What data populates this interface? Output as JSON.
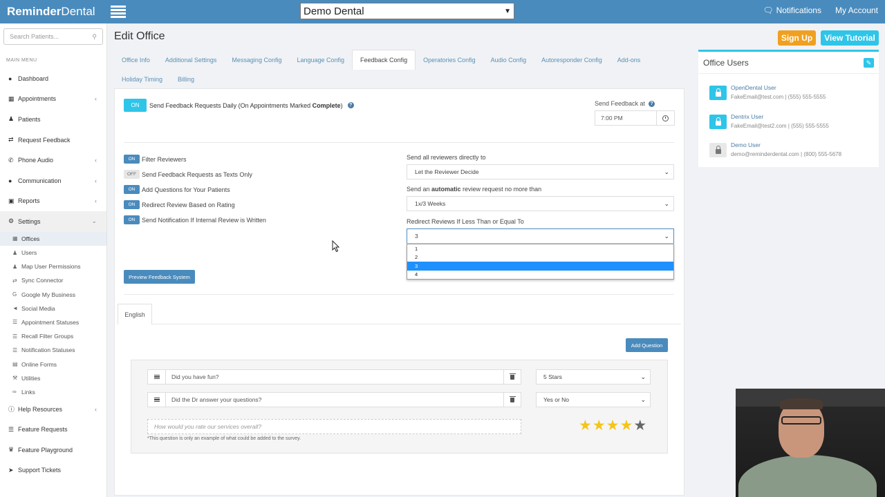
{
  "app": {
    "brand_bold": "Reminder",
    "brand_rest": "Dental",
    "office_selected": "Demo Dental",
    "notifications_label": "Notifications",
    "account_label": "My Account"
  },
  "sidebar": {
    "search_placeholder": "Search Patients...",
    "main_menu_label": "MAIN MENU",
    "items": [
      {
        "label": "Dashboard",
        "icon": "tachometer-icon"
      },
      {
        "label": "Appointments",
        "icon": "calendar-icon"
      },
      {
        "label": "Patients",
        "icon": "users-icon"
      },
      {
        "label": "Request Feedback",
        "icon": "exchange-icon"
      },
      {
        "label": "Phone Audio",
        "icon": "phone-icon"
      },
      {
        "label": "Communication",
        "icon": "chat-icon"
      },
      {
        "label": "Reports",
        "icon": "briefcase-icon"
      },
      {
        "label": "Settings",
        "icon": "gears-icon"
      }
    ],
    "settings_sub": [
      {
        "label": "Offices",
        "icon": "building-icon"
      },
      {
        "label": "Users",
        "icon": "user-icon"
      },
      {
        "label": "Map User Permissions",
        "icon": "user-icon"
      },
      {
        "label": "Sync Connector",
        "icon": "exchange-icon"
      },
      {
        "label": "Google My Business",
        "icon": "google-icon"
      },
      {
        "label": "Social Media",
        "icon": "megaphone-icon"
      },
      {
        "label": "Appointment Statuses",
        "icon": "list-icon"
      },
      {
        "label": "Recall Filter Groups",
        "icon": "list-icon"
      },
      {
        "label": "Notification Statuses",
        "icon": "list-icon"
      },
      {
        "label": "Online Forms",
        "icon": "file-icon"
      },
      {
        "label": "Utilities",
        "icon": "wrench-icon"
      },
      {
        "label": "Links",
        "icon": "link-icon"
      }
    ],
    "bottom_items": [
      {
        "label": "Help Resources",
        "icon": "info-icon"
      },
      {
        "label": "Feature Requests",
        "icon": "list-icon"
      },
      {
        "label": "Feature Playground",
        "icon": "trophy-icon"
      },
      {
        "label": "Support Tickets",
        "icon": "rocket-icon"
      }
    ]
  },
  "header": {
    "title": "Edit Office",
    "signup_label": "Sign Up",
    "tutorial_label": "View Tutorial"
  },
  "tabs": {
    "row1": [
      "Office Info",
      "Additional Settings",
      "Messaging Config",
      "Language Config",
      "Feedback Config",
      "Operatories Config",
      "Audio Config",
      "Autoresponder Config",
      "Add-ons"
    ],
    "row2": [
      "Holiday Timing",
      "Billing"
    ],
    "active": "Feedback Config"
  },
  "feedback": {
    "daily_toggle": "ON",
    "daily_label_pre": "Send Feedback Requests Daily (On Appointments Marked ",
    "daily_label_bold": "Complete",
    "daily_label_post": ")",
    "send_at_label": "Send Feedback at",
    "send_at_value": "7:00 PM",
    "options": [
      {
        "state": "ON",
        "label": "Filter Reviewers"
      },
      {
        "state": "OFF",
        "label": "Send Feedback Requests as Texts Only"
      },
      {
        "state": "ON",
        "label": "Add Questions for Your Patients"
      },
      {
        "state": "ON",
        "label": "Redirect Review Based on Rating"
      },
      {
        "state": "ON",
        "label": "Send Notification If Internal Review is Written"
      }
    ],
    "direct_label": "Send all reviewers directly to",
    "direct_value": "Let the Reviewer Decide",
    "auto_label_pre": "Send an ",
    "auto_label_bold": "automatic",
    "auto_label_post": " review request no more than",
    "auto_value": "1x/3 Weeks",
    "redirect_label": "Redirect Reviews If Less Than or Equal To",
    "redirect_value": "3",
    "redirect_options": [
      "1",
      "2",
      "3",
      "4"
    ],
    "preview_label": "Preview Feedback System"
  },
  "questions": {
    "language_tab": "English",
    "add_label": "Add Question",
    "items": [
      {
        "text": "Did you have fun?",
        "type": "5 Stars"
      },
      {
        "text": "Did the Dr answer your questions?",
        "type": "Yes or No"
      }
    ],
    "example_placeholder": "How would you rate our services overall?",
    "example_note": "*This question is only an example of what could be added to the survey.",
    "example_rating": 4,
    "example_rating_max": 5
  },
  "office_users": {
    "title": "Office Users",
    "users": [
      {
        "name": "OpenDental User",
        "meta": "FakeEmail@test.com | (555) 555-5555",
        "style": "blue"
      },
      {
        "name": "Dentrix User",
        "meta": "FakeEmail@test2.com | (555) 555-5555",
        "style": "blue"
      },
      {
        "name": "Demo User",
        "meta": "demo@reminderdental.com | (800) 555-5678",
        "style": "grey"
      }
    ]
  },
  "colors": {
    "primary": "#4a8bbd",
    "accent": "#2fc5e8",
    "signup": "#f0a020",
    "star": "#f5c518"
  }
}
